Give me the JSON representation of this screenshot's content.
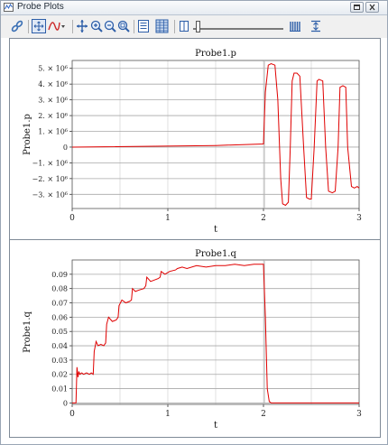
{
  "window": {
    "title": "Probe Plots",
    "buttons": [
      "restore",
      "close"
    ]
  },
  "toolbar": {
    "icons": [
      "link-icon",
      "fit-icon",
      "line-style-icon",
      "pan-icon",
      "zoom-in-icon",
      "zoom-out-icon",
      "zoom-box-icon",
      "legend-icon",
      "table-icon",
      "split-icon",
      "slider-icon",
      "grid-icon",
      "export-icon"
    ],
    "slider_value": 0.05
  },
  "colors": {
    "series": "#e00000",
    "grid": "#a8a8a8",
    "minor_grid": "#d8d8d8",
    "marker_line": "#b7b7b7"
  },
  "chart_data": [
    {
      "type": "line",
      "title": "Probe1.p",
      "xlabel": "t",
      "ylabel": "Probe1.p",
      "xlim": [
        0,
        3
      ],
      "ylim": [
        -3900000.0,
        5500000.0
      ],
      "xticks": [
        0,
        1,
        2,
        3
      ],
      "xtick_labels": [
        "0",
        "1",
        "2",
        "3"
      ],
      "yticks": [
        -3000000.0,
        -2000000.0,
        -1000000.0,
        0,
        1000000.0,
        2000000.0,
        3000000.0,
        4000000.0,
        5000000.0
      ],
      "ytick_labels": [
        "−3. × 10⁶",
        "−2. × 10⁶",
        "−1. × 10⁶",
        "0",
        "1. × 10⁶",
        "2. × 10⁶",
        "3. × 10⁶",
        "4. × 10⁶",
        "5. × 10⁶"
      ],
      "grid": true,
      "marker_x": 2.0,
      "series": [
        {
          "x": [
            0,
            1.5,
            2.0,
            2.02,
            2.05,
            2.08,
            2.12,
            2.15,
            2.18,
            2.2,
            2.23,
            2.26,
            2.28,
            2.3,
            2.32,
            2.35,
            2.38,
            2.42,
            2.45,
            2.48,
            2.5,
            2.53,
            2.56,
            2.58,
            2.62,
            2.65,
            2.68,
            2.72,
            2.75,
            2.78,
            2.8,
            2.83,
            2.86,
            2.88,
            2.92,
            2.95,
            2.98,
            3.0
          ],
          "y": [
            0,
            100000,
            200000,
            3500000,
            5200000,
            5300000,
            5200000,
            3000000,
            -2000000,
            -3600000,
            -3700000,
            -3500000,
            0,
            4200000,
            4700000,
            4700000,
            4500000,
            0,
            -3200000,
            -3300000,
            -3300000,
            0,
            4200000,
            4300000,
            4200000,
            0,
            -2800000,
            -2900000,
            -2800000,
            0,
            3800000,
            3900000,
            3800000,
            0,
            -2500000,
            -2600000,
            -2500000,
            -2600000
          ]
        }
      ]
    },
    {
      "type": "line",
      "title": "Probe1.q",
      "xlabel": "t",
      "ylabel": "Probe1.q",
      "xlim": [
        0,
        3
      ],
      "ylim": [
        -0.001,
        0.1
      ],
      "xticks": [
        0,
        1,
        2,
        3
      ],
      "xtick_labels": [
        "0",
        "1",
        "2",
        "3"
      ],
      "yticks": [
        0,
        0.01,
        0.02,
        0.03,
        0.04,
        0.05,
        0.06,
        0.07,
        0.08,
        0.09
      ],
      "ytick_labels": [
        "0",
        "0.01",
        "0.02",
        "0.03",
        "0.04",
        "0.05",
        "0.06",
        "0.07",
        "0.08",
        "0.09"
      ],
      "grid": true,
      "marker_x": 2.0,
      "series": [
        {
          "x": [
            0,
            0.04,
            0.05,
            0.06,
            0.07,
            0.08,
            0.1,
            0.12,
            0.15,
            0.18,
            0.2,
            0.22,
            0.23,
            0.25,
            0.27,
            0.3,
            0.33,
            0.35,
            0.36,
            0.38,
            0.42,
            0.46,
            0.48,
            0.49,
            0.52,
            0.56,
            0.6,
            0.62,
            0.63,
            0.66,
            0.7,
            0.75,
            0.77,
            0.78,
            0.82,
            0.86,
            0.9,
            0.92,
            0.93,
            0.97,
            1.02,
            1.08,
            1.1,
            1.15,
            1.2,
            1.3,
            1.4,
            1.5,
            1.6,
            1.7,
            1.8,
            1.9,
            1.98,
            2.0,
            2.02,
            2.04,
            2.06,
            2.08,
            2.1,
            2.5,
            3.0
          ],
          "y": [
            0,
            0,
            0.025,
            0.018,
            0.022,
            0.02,
            0.021,
            0.02,
            0.021,
            0.02,
            0.021,
            0.02,
            0.036,
            0.043,
            0.04,
            0.041,
            0.04,
            0.042,
            0.055,
            0.06,
            0.057,
            0.058,
            0.06,
            0.068,
            0.072,
            0.07,
            0.071,
            0.072,
            0.08,
            0.078,
            0.079,
            0.08,
            0.082,
            0.088,
            0.085,
            0.086,
            0.087,
            0.088,
            0.092,
            0.09,
            0.092,
            0.093,
            0.094,
            0.095,
            0.094,
            0.096,
            0.095,
            0.096,
            0.096,
            0.097,
            0.096,
            0.097,
            0.097,
            0.097,
            0.06,
            0.01,
            0.001,
            0,
            0,
            0,
            0
          ]
        }
      ]
    }
  ]
}
